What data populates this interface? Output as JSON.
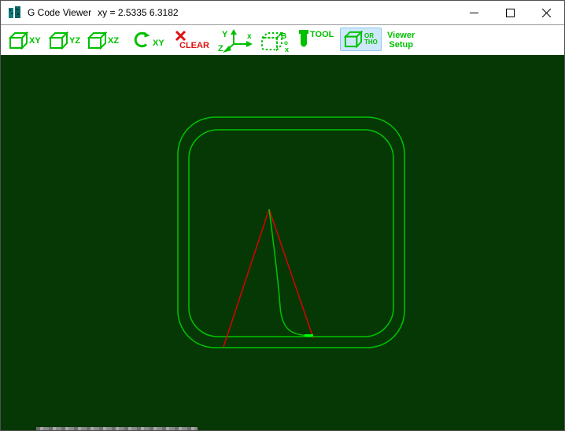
{
  "window": {
    "title": "G Code Viewer",
    "coordinates": "xy = 2.5335 6.3182"
  },
  "toolbar": {
    "view_xy_label": "XY",
    "view_yz_label": "YZ",
    "view_xz_label": "XZ",
    "rotate_xy_label": "XY",
    "clear_label": "CLEAR",
    "axis_labels": {
      "y": "Y",
      "x": "x",
      "z": "Z"
    },
    "box_labels": {
      "b": "B",
      "o": "o",
      "x": "x"
    },
    "tool_label": "TOOL",
    "ortho_label": {
      "line1": "OR",
      "line2": "THO"
    },
    "viewer_setup_label": {
      "line1": "Viewer",
      "line2": "Setup"
    }
  },
  "colors": {
    "toolbar_green": "#00c000",
    "clear_red": "#dd1111",
    "canvas_bg": "#053805",
    "path_green": "#00c400",
    "path_bright_green": "#00ff00",
    "path_red": "#dd0000",
    "ortho_bg": "#cde8fb",
    "ortho_border": "#8ec6f0",
    "icon_teal": "#0e7c7b"
  }
}
